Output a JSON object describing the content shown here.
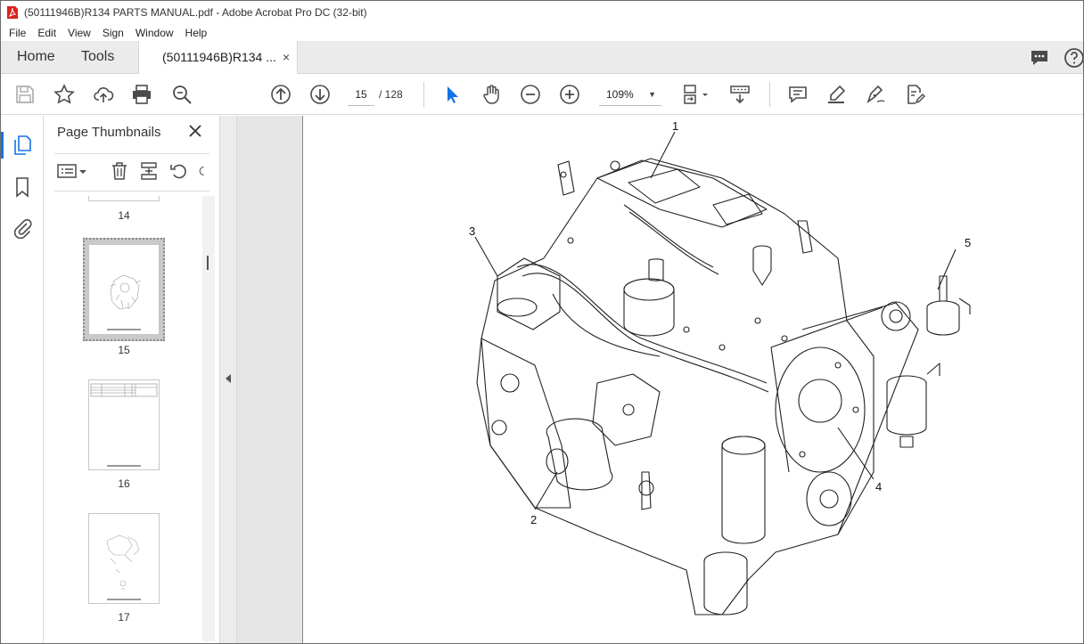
{
  "window": {
    "title": "(50111946B)R134 PARTS MANUAL.pdf - Adobe Acrobat Pro DC (32-bit)"
  },
  "menu": {
    "items": [
      "File",
      "Edit",
      "View",
      "Sign",
      "Window",
      "Help"
    ]
  },
  "tabs": {
    "home": "Home",
    "tools": "Tools",
    "document": "(50111946B)R134 ...",
    "close": "×"
  },
  "toolbar": {
    "current_page": "15",
    "page_of": "/   128",
    "zoom": "109%",
    "zoom_dropdown": "▼"
  },
  "thumbnails_panel": {
    "title": "Page Thumbnails",
    "pages": [
      {
        "label": "14"
      },
      {
        "label": "15",
        "selected": true
      },
      {
        "label": "16"
      },
      {
        "label": "17"
      }
    ]
  },
  "page_content": {
    "callouts": [
      "1",
      "2",
      "3",
      "4",
      "5"
    ]
  },
  "colors": {
    "acrobat_red": "#d7231d",
    "accent_blue": "#1473e6",
    "icon_gray": "#4b4b4b"
  }
}
